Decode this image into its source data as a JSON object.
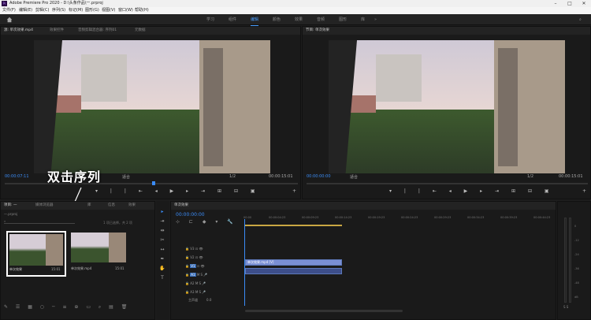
{
  "titlebar": {
    "title": "Adobe Premiere Pro 2020 - D:\\头条作品\\一.prproj",
    "logo": "Pr"
  },
  "menu": [
    "文件(F)",
    "编辑(E)",
    "剪辑(C)",
    "序列(S)",
    "标记(M)",
    "图形(G)",
    "视图(V)",
    "窗口(W)",
    "帮助(H)"
  ],
  "workspaces": [
    {
      "label": "学习",
      "active": false
    },
    {
      "label": "组件",
      "active": false
    },
    {
      "label": "编辑",
      "active": true
    },
    {
      "label": "颜色",
      "active": false
    },
    {
      "label": "效果",
      "active": false
    },
    {
      "label": "音频",
      "active": false
    },
    {
      "label": "图形",
      "active": false
    },
    {
      "label": "库",
      "active": false
    }
  ],
  "source_panel": {
    "tabs": [
      "源: 单次效果.mp4",
      "效果控件",
      "音频剪辑混合器: 序列01",
      "元数据"
    ],
    "timecode_in": "00:00:07:11",
    "zoom": "适合",
    "ratio": "1/2",
    "timecode_out": "00:00:15:01"
  },
  "program_panel": {
    "tabs": [
      "节目: 单次效果"
    ],
    "timecode_in": "00:00:00:00",
    "zoom": "适合",
    "ratio": "1/2",
    "timecode_out": "00:00:15:01"
  },
  "caption": "双击序列",
  "project_panel": {
    "tabs": [
      "项目: 一",
      "媒体浏览器",
      "库",
      "信息",
      "效果"
    ],
    "path": "一.prproj",
    "item_count": "1 项已选择，共 2 项",
    "items": [
      {
        "name": "单次效果",
        "duration": "15:01"
      },
      {
        "name": "单次效果.mp4",
        "duration": "15:01"
      }
    ]
  },
  "timeline": {
    "tab": "单次效果",
    "timecode": "00:00:00:00",
    "ruler": [
      "00:00",
      "00:00:04:23",
      "00:00:09:23",
      "00:00:14:23",
      "00:00:19:23",
      "00:00:24:23",
      "00:00:29:23",
      "00:00:34:23",
      "00:00:39:23",
      "00:00:44:23"
    ],
    "tracks": [
      "V3",
      "V2",
      "V1",
      "A1",
      "A2",
      "A3"
    ],
    "master": "主声道",
    "master_value": "0.0",
    "video_clip": "单次效果.mp4 [V]"
  },
  "meter": {
    "labels": [
      "0",
      "-12",
      "-24",
      "-36",
      "-48",
      "dB"
    ]
  },
  "colors": {
    "accent": "#3b8cf7",
    "active_ws": "#4a9fff",
    "clip_video": "#7a8fd4",
    "clip_audio": "#3d4e8a"
  }
}
